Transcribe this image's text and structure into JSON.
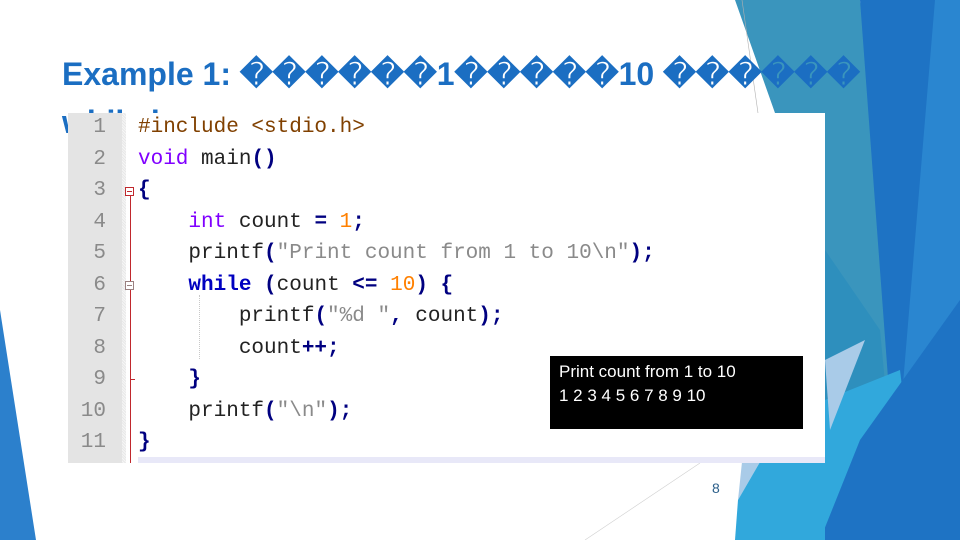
{
  "slide": {
    "title_line1": "Example 1: ������1�����10 ������",
    "title_line2": "while loop",
    "slide_number": "8",
    "accent_color": "#1b6ec2"
  },
  "code_editor": {
    "lines": [
      {
        "num": "1",
        "tokens": [
          {
            "t": "#include <stdio.h>",
            "c": "pp"
          }
        ]
      },
      {
        "num": "2",
        "tokens": [
          {
            "t": "void",
            "c": "kw"
          },
          {
            "t": " main",
            "c": "id"
          },
          {
            "t": "()",
            "c": "op"
          }
        ]
      },
      {
        "num": "3",
        "tokens": [
          {
            "t": "{",
            "c": "op"
          }
        ]
      },
      {
        "num": "4",
        "tokens": [
          {
            "t": "    ",
            "c": "id"
          },
          {
            "t": "int",
            "c": "kw"
          },
          {
            "t": " count ",
            "c": "id"
          },
          {
            "t": "=",
            "c": "op"
          },
          {
            "t": " ",
            "c": "id"
          },
          {
            "t": "1",
            "c": "num"
          },
          {
            "t": ";",
            "c": "op"
          }
        ]
      },
      {
        "num": "5",
        "tokens": [
          {
            "t": "    printf",
            "c": "id"
          },
          {
            "t": "(",
            "c": "op"
          },
          {
            "t": "\"Print count from 1 to 10\\n\"",
            "c": "str"
          },
          {
            "t": ");",
            "c": "op"
          }
        ]
      },
      {
        "num": "6",
        "tokens": [
          {
            "t": "    ",
            "c": "id"
          },
          {
            "t": "while",
            "c": "kwb"
          },
          {
            "t": " ",
            "c": "id"
          },
          {
            "t": "(",
            "c": "op"
          },
          {
            "t": "count ",
            "c": "id"
          },
          {
            "t": "<=",
            "c": "op"
          },
          {
            "t": " ",
            "c": "id"
          },
          {
            "t": "10",
            "c": "num"
          },
          {
            "t": ")",
            "c": "op"
          },
          {
            "t": " ",
            "c": "id"
          },
          {
            "t": "{",
            "c": "op"
          }
        ]
      },
      {
        "num": "7",
        "tokens": [
          {
            "t": "        printf",
            "c": "id"
          },
          {
            "t": "(",
            "c": "op"
          },
          {
            "t": "\"%d \"",
            "c": "str"
          },
          {
            "t": ",",
            "c": "op"
          },
          {
            "t": " count",
            "c": "id"
          },
          {
            "t": ");",
            "c": "op"
          }
        ]
      },
      {
        "num": "8",
        "tokens": [
          {
            "t": "        count",
            "c": "id"
          },
          {
            "t": "++;",
            "c": "op"
          }
        ]
      },
      {
        "num": "9",
        "tokens": [
          {
            "t": "    ",
            "c": "id"
          },
          {
            "t": "}",
            "c": "op"
          }
        ]
      },
      {
        "num": "10",
        "tokens": [
          {
            "t": "    printf",
            "c": "id"
          },
          {
            "t": "(",
            "c": "op"
          },
          {
            "t": "\"\\n\"",
            "c": "str"
          },
          {
            "t": ");",
            "c": "op"
          }
        ]
      },
      {
        "num": "11",
        "tokens": [
          {
            "t": "}",
            "c": "op"
          }
        ]
      }
    ]
  },
  "console_output": {
    "lines": [
      "Print count from 1 to 10",
      "1 2 3 4 5 6 7 8 9 10"
    ]
  },
  "theme_colors": {
    "deco_dark_blue": "#1e73c4",
    "deco_mid_blue": "#2a86d0",
    "deco_teal": "#3a95bd",
    "deco_sky": "#31a8dc",
    "deco_light": "#a9cbe8"
  }
}
